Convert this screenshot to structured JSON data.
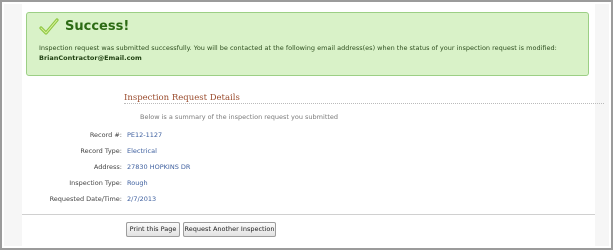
{
  "success": {
    "title": "Success!",
    "message": "Inspection request was submitted successfully. You will be contacted at the following email address(es) when the status of your inspection request is modified:",
    "email": "BrianContractor@Email.com",
    "accent": "#2c6b14",
    "background": "#d9f2c8"
  },
  "details": {
    "header": "Inspection Request Details",
    "summary": "Below is a summary of the inspection request you submitted",
    "fields": [
      {
        "label": "Record #:",
        "value": "PE12-1127"
      },
      {
        "label": "Record Type:",
        "value": "Electrical"
      },
      {
        "label": "Address:",
        "value": "27830 HOPKINS DR"
      },
      {
        "label": "Inspection Type:",
        "value": "Rough"
      },
      {
        "label": "Requested Date/Time:",
        "value": "2/7/2013"
      }
    ]
  },
  "buttons": {
    "print": "Print this Page",
    "request_another": "Request Another Inspection"
  }
}
